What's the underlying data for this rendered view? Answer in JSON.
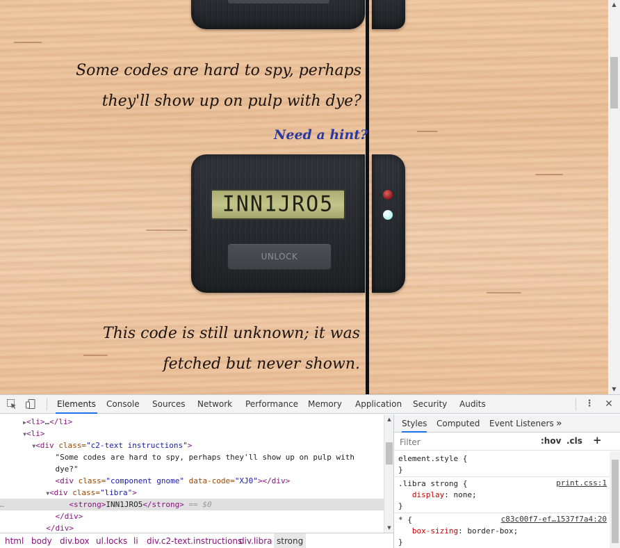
{
  "page": {
    "verse1_line1": "Some codes are hard to spy, perhaps",
    "verse1_line2": "they'll show up on pulp with dye?",
    "hint_link": "Need a hint?",
    "lcd_text": "INN1JRO5",
    "unlock_label": "UNLOCK",
    "verse2_line1": "This code is still unknown; it was",
    "verse2_line2": "fetched but never shown."
  },
  "devtools": {
    "tabs": [
      "Elements",
      "Console",
      "Sources",
      "Network",
      "Performance",
      "Memory",
      "Application",
      "Security",
      "Audits"
    ],
    "dom": {
      "l1_tag": "<li>",
      "l1_dots": "…",
      "l1_close": "</li>",
      "l2_tag": "<li>",
      "l3_open": "<div ",
      "l3_attr": "class=",
      "l3_val": "\"c2-text instructions\"",
      "l3_close": ">",
      "l4_text": "\"Some codes are hard to spy, perhaps they'll show up on pulp with",
      "l5_text": "dye?\"",
      "l6_open": "<div ",
      "l6_attr1": "class=",
      "l6_val1": "\"component gnome\"",
      "l6_attr2": " data-code=",
      "l6_val2": "\"XJ0\"",
      "l6_close": "></div>",
      "l7_open": "<div ",
      "l7_attr": "class=",
      "l7_val": "\"libra\"",
      "l7_close": ">",
      "l8_open": "<strong>",
      "l8_text": "INN1JRO5",
      "l8_close": "</strong>",
      "l8_eq": " == $0",
      "l9_close": "</div>",
      "l10_close": "</div>",
      "ellipsis": "…"
    },
    "breadcrumbs": [
      "html",
      "body",
      "div.box",
      "ul.locks",
      "li",
      "div.c2-text.instructions",
      "div.libra",
      "strong"
    ],
    "styles": {
      "tabs": [
        "Styles",
        "Computed",
        "Event Listeners"
      ],
      "more": "»",
      "filter_placeholder": "Filter",
      "hov": ":hov",
      "cls": ".cls",
      "plus": "+",
      "rule1_selector": "element.style {",
      "rule1_close": "}",
      "rule2_selector": ".libra strong {",
      "rule2_source": "print.css:1",
      "rule2_prop": "display",
      "rule2_val": "none;",
      "rule2_close": "}",
      "rule3_selector": "* {",
      "rule3_source": "c83c00f7-ef…1537f7a4:20",
      "rule3_prop": "box-sizing",
      "rule3_val": "border-box;",
      "rule3_close": "}"
    }
  }
}
